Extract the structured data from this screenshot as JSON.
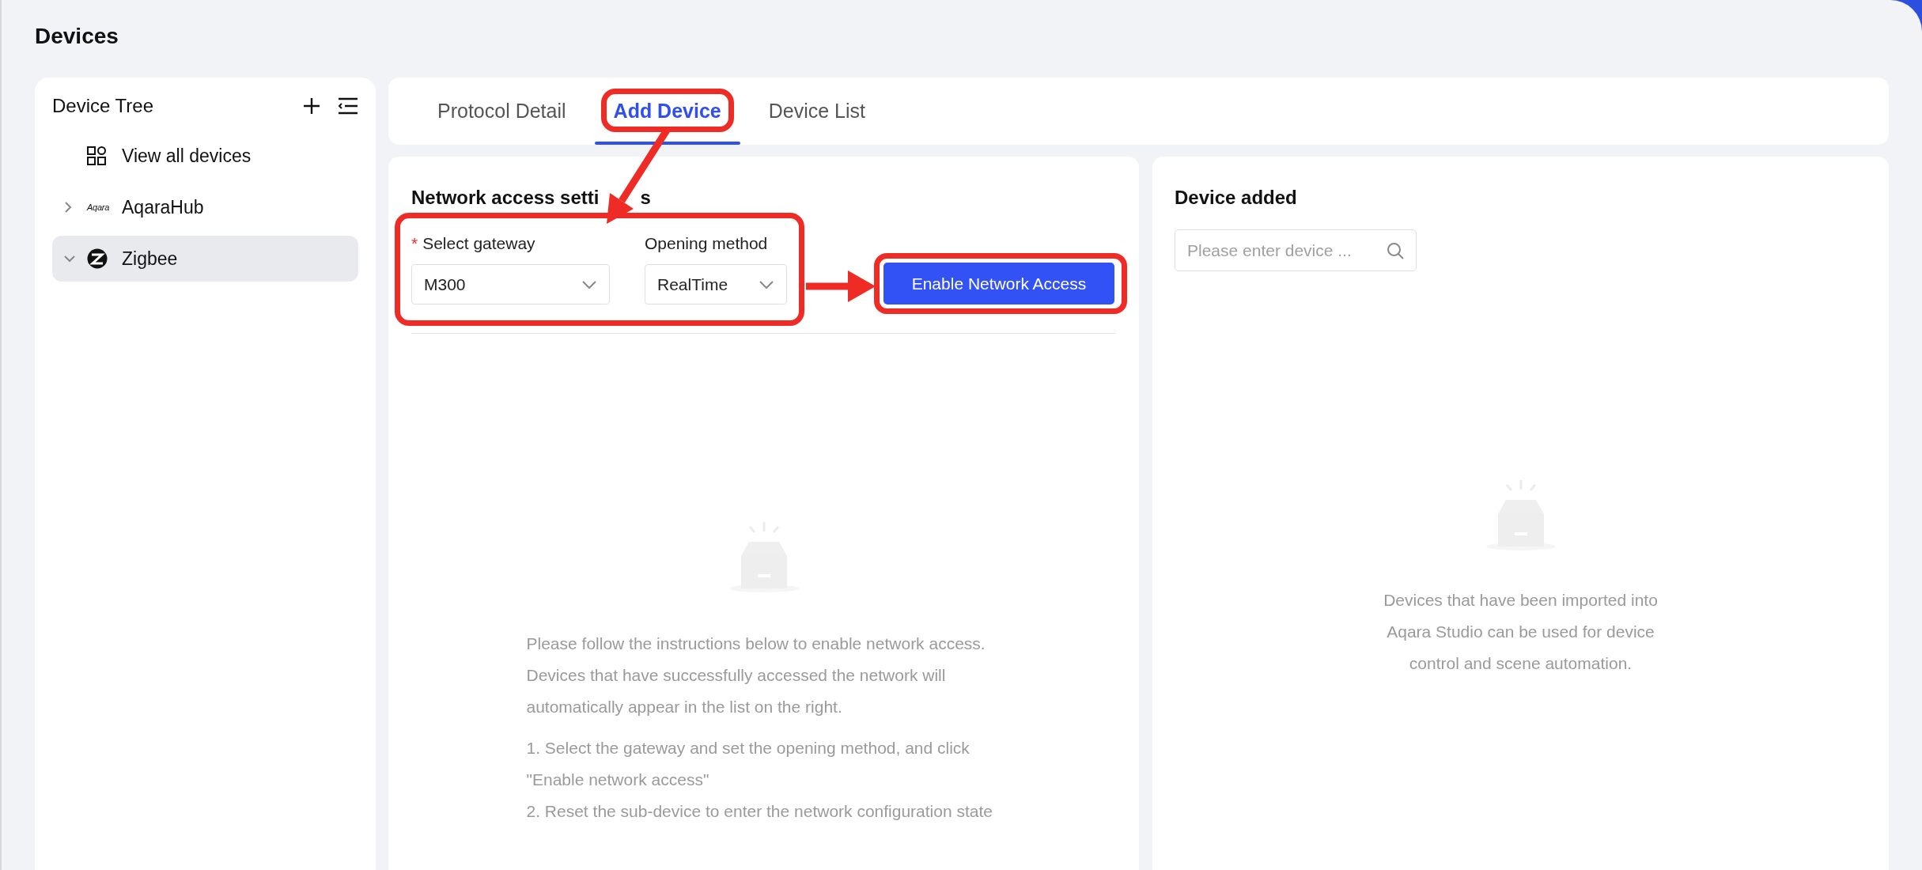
{
  "page_title": "Devices",
  "device_tree": {
    "title": "Device Tree",
    "items": [
      {
        "kind": "all",
        "label": "View all devices",
        "selected": false
      },
      {
        "kind": "aqara",
        "label": "AqaraHub",
        "logo_text": "Aqara",
        "expanded": false,
        "selected": false
      },
      {
        "kind": "zigbee",
        "label": "Zigbee",
        "expanded": true,
        "selected": true
      }
    ]
  },
  "tabs": [
    {
      "label": "Protocol Detail",
      "selected": false,
      "highlighted": false
    },
    {
      "label": "Add Device",
      "selected": true,
      "highlighted": true
    },
    {
      "label": "Device List",
      "selected": false,
      "highlighted": false
    }
  ],
  "network_settings": {
    "title": "Network access setti",
    "title_tail": "s",
    "highlighted": true,
    "fields": [
      {
        "label": "Select gateway",
        "required_mark": "*",
        "value": "M300"
      },
      {
        "label": "Opening method",
        "value": "RealTime"
      }
    ],
    "button": {
      "label": "Enable Network Access",
      "highlighted": true
    },
    "empty_text": "Please follow the instructions below to enable network access. Devices that have successfully accessed the network will automatically appear in the list on the right.",
    "steps": [
      "1. Select the gateway and set the opening method, and click \"Enable network access\"",
      "2. Reset the sub-device to enter the network configuration state"
    ]
  },
  "device_added": {
    "title": "Device added",
    "search": {
      "placeholder": "Please enter device ..."
    },
    "empty_text": "Devices that have been imported into Aqara Studio can be used for device control and scene automation."
  }
}
